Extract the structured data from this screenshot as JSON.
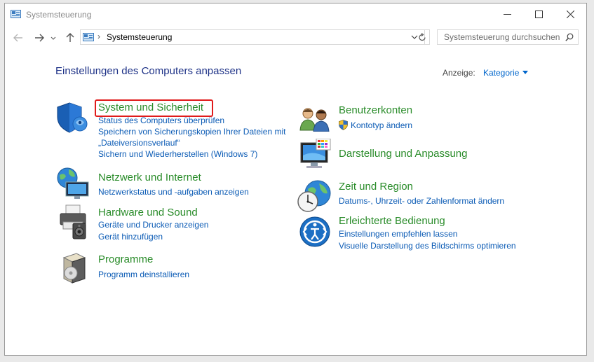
{
  "window": {
    "title": "Systemsteuerung"
  },
  "navigation": {
    "address_path": "Systemsteuerung",
    "search_placeholder": "Systemsteuerung durchsuchen"
  },
  "main": {
    "heading": "Einstellungen des Computers anpassen",
    "view_label": "Anzeige:",
    "view_value": "Kategorie"
  },
  "categories": {
    "system": {
      "title": "System und Sicherheit",
      "links": [
        "Status des Computers überprüfen",
        "Speichern von Sicherungskopien Ihrer Dateien mit",
        "„Dateiversionsverlauf“",
        "Sichern und Wiederherstellen (Windows 7)"
      ]
    },
    "network": {
      "title": "Netzwerk und Internet",
      "links": [
        "Netzwerkstatus und -aufgaben anzeigen"
      ]
    },
    "hardware": {
      "title": "Hardware und Sound",
      "links": [
        "Geräte und Drucker anzeigen",
        "Gerät hinzufügen"
      ]
    },
    "programs": {
      "title": "Programme",
      "links": [
        "Programm deinstallieren"
      ]
    },
    "users": {
      "title": "Benutzerkonten",
      "links": [
        "Kontotyp ändern"
      ]
    },
    "appearance": {
      "title": "Darstellung und Anpassung",
      "links": []
    },
    "clock": {
      "title": "Zeit und Region",
      "links": [
        "Datums-, Uhrzeit- oder Zahlenformat ändern"
      ]
    },
    "access": {
      "title": "Erleichterte Bedienung",
      "links": [
        "Einstellungen empfehlen lassen",
        "Visuelle Darstellung des Bildschirms optimieren"
      ]
    }
  },
  "colors": {
    "category_title": "#2a8c2a",
    "link": "#0b5bb5",
    "heading": "#1e3287",
    "highlight_border": "#e01b1b"
  }
}
